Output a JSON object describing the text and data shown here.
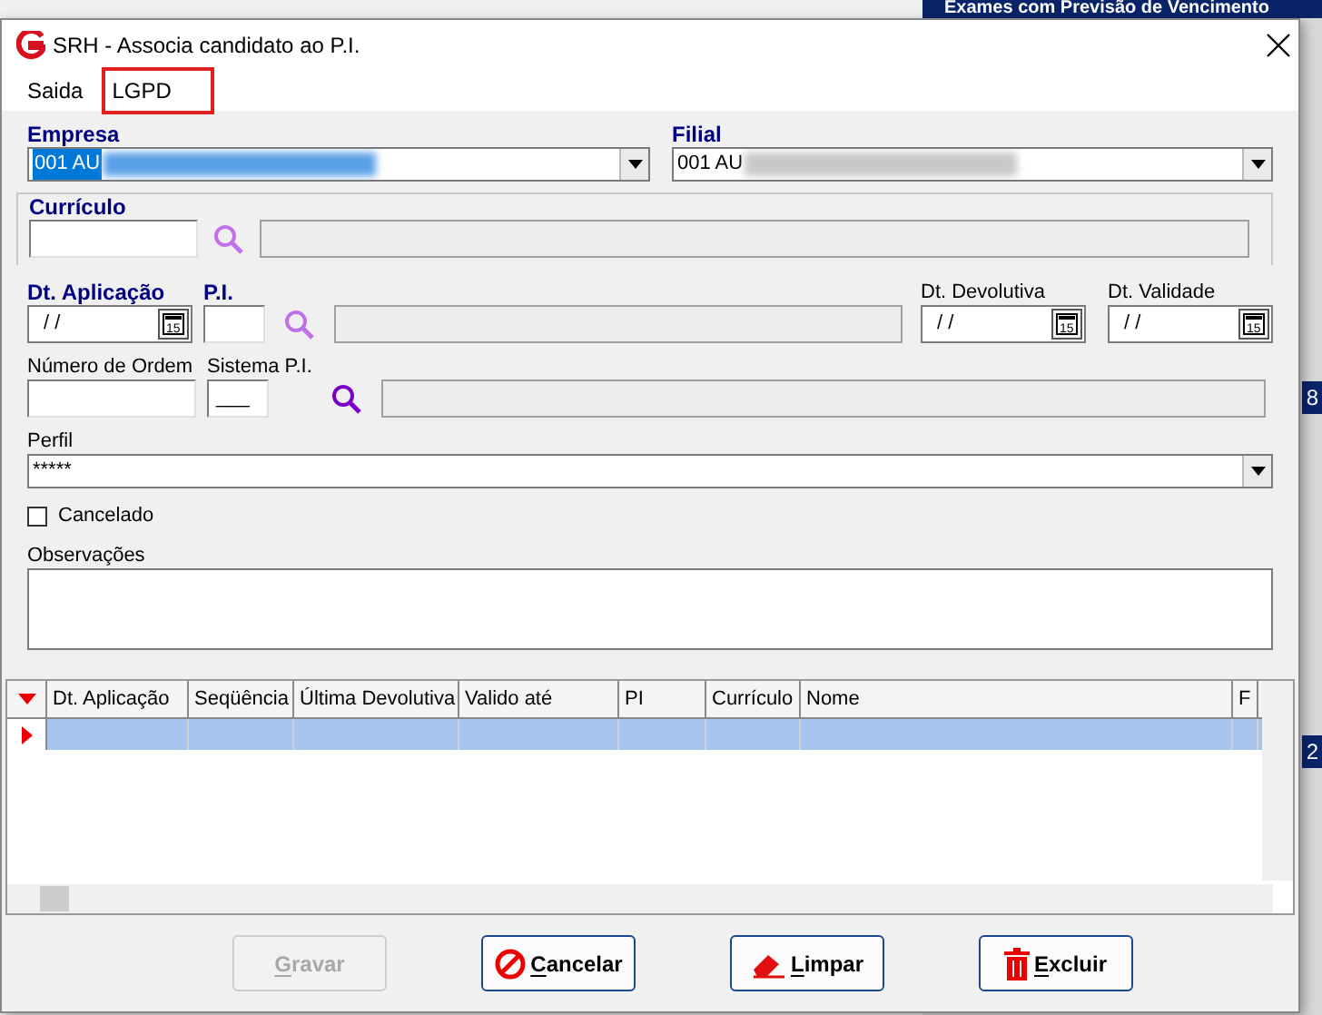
{
  "background_window": {
    "title": "Exames com Previsão de Vencimento",
    "fragments": [
      "8",
      "2"
    ]
  },
  "window": {
    "title": "SRH - Associa candidato ao P.I."
  },
  "menu": [
    {
      "label": "Saida",
      "highlighted": false
    },
    {
      "label": "LGPD",
      "highlighted": true
    }
  ],
  "empresa": {
    "label": "Empresa",
    "value": "001 AU",
    "selected": true
  },
  "filial": {
    "label": "Filial",
    "value": "001 AU"
  },
  "curriculo": {
    "label": "Currículo"
  },
  "dt_aplicacao": {
    "label": "Dt. Aplicação",
    "value": "/ /",
    "calendar_icon_text": "15"
  },
  "pi": {
    "label": "P.I."
  },
  "dt_devolutiva": {
    "label": "Dt. Devolutiva",
    "value": "/ /",
    "calendar_icon_text": "15"
  },
  "dt_validade": {
    "label": "Dt. Validade",
    "value": "/ /",
    "calendar_icon_text": "15"
  },
  "numero_ordem": {
    "label": "Número de Ordem"
  },
  "sistema_pi": {
    "label": "Sistema P.I.",
    "value": "___"
  },
  "perfil": {
    "label": "Perfil",
    "value": "*****"
  },
  "cancelado": {
    "label": "Cancelado",
    "checked": false
  },
  "observacoes": {
    "label": "Observações"
  },
  "table": {
    "columns": [
      "Dt. Aplicação",
      "Seqüência",
      "Última Devolutiva",
      "Valido até",
      "PI",
      "Currículo",
      "Nome",
      "F"
    ],
    "rows": [
      {
        "selected": true
      }
    ]
  },
  "buttons": [
    {
      "kind": "save",
      "label": "Gravar",
      "disabled": true
    },
    {
      "kind": "cancel",
      "label": "Cancelar",
      "disabled": false
    },
    {
      "kind": "clear",
      "label": "Limpar",
      "disabled": false
    },
    {
      "kind": "delete",
      "label": "Excluir",
      "disabled": false
    }
  ]
}
